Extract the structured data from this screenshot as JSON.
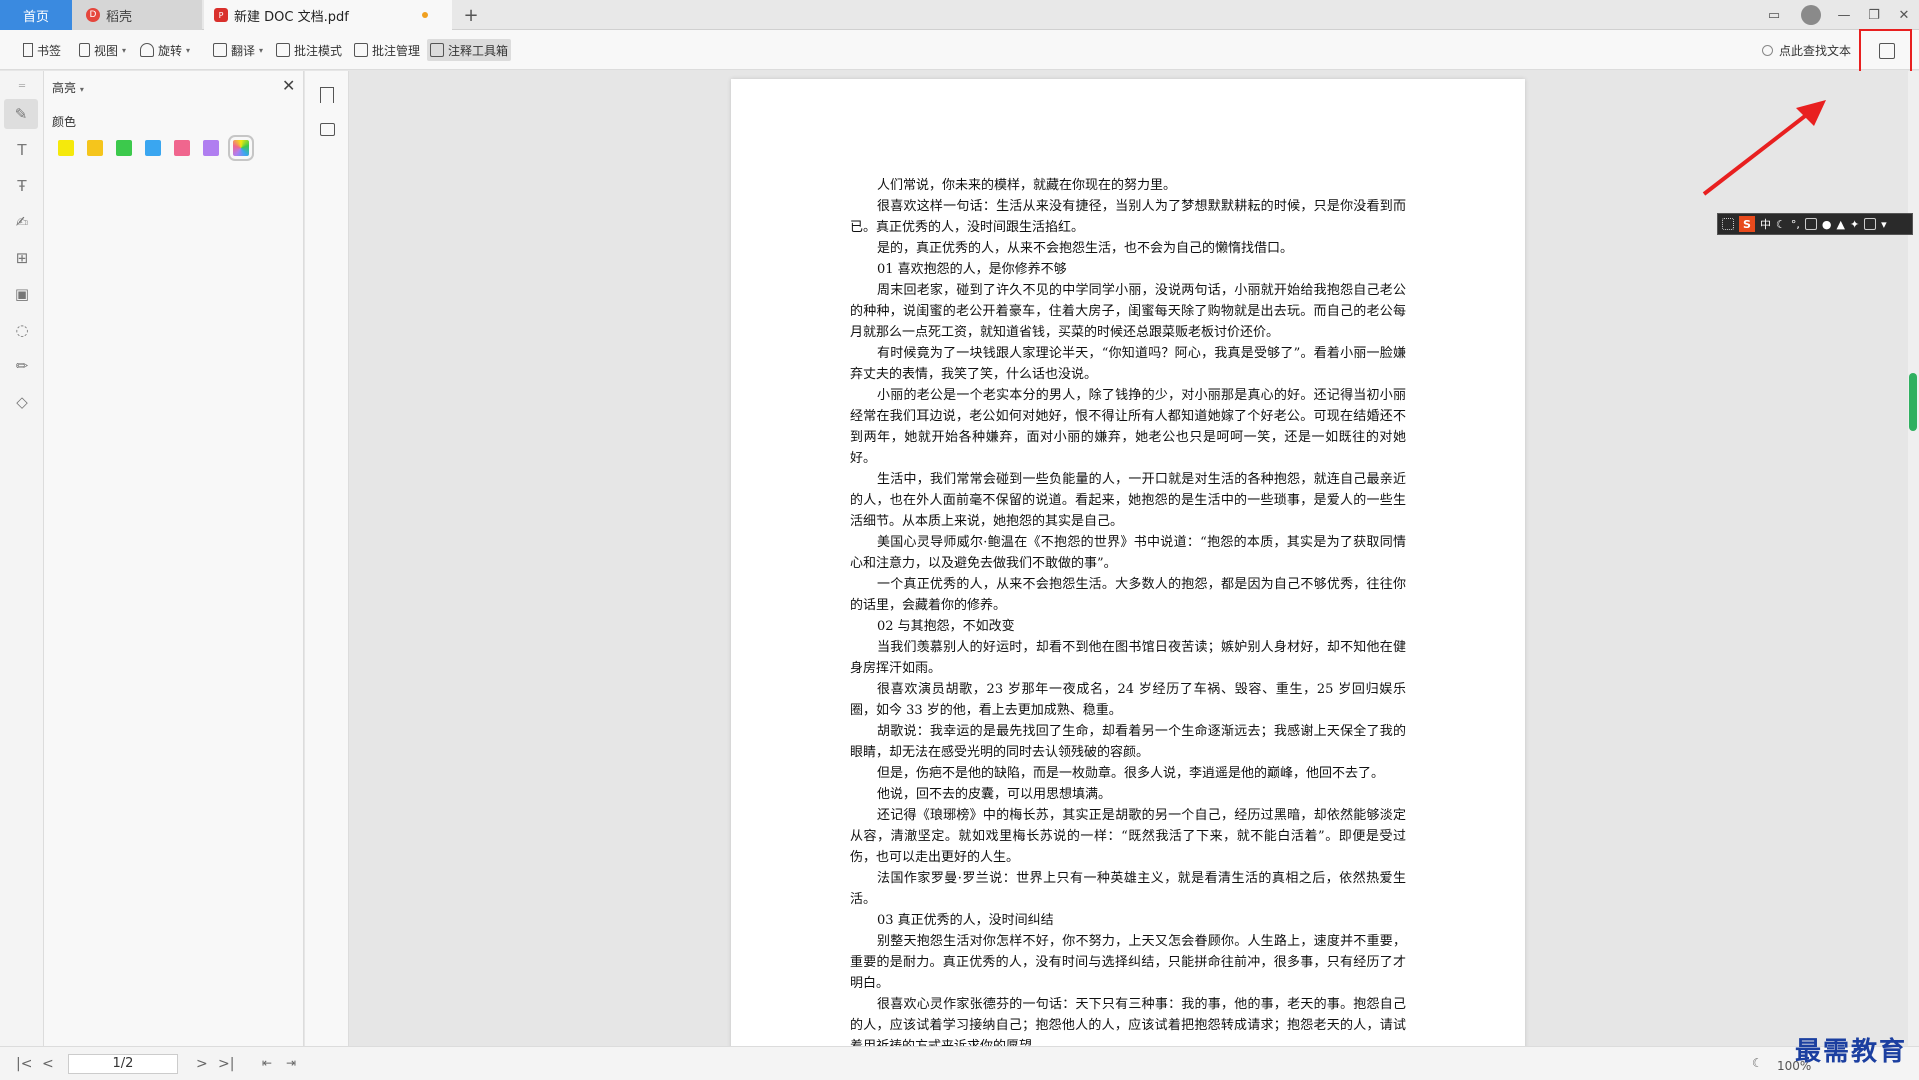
{
  "tabs": {
    "home": "首页",
    "docer": "稻壳",
    "pdf": "新建 DOC 文档.pdf",
    "add": "+"
  },
  "toolbar": {
    "bookmark": "书签",
    "view": "视图",
    "rotate": "旋转",
    "translate": "翻译",
    "annotation_mode": "批注模式",
    "annotation_manage": "批注管理",
    "annotation_toolbox": "注释工具箱",
    "find_text": "点此查找文本"
  },
  "highlight_panel": {
    "title": "高亮",
    "color_label": "颜色",
    "colors": [
      "#f5e90c",
      "#f5c51c",
      "#3cc94c",
      "#3aa6f0",
      "#f0668e",
      "#b07ef0"
    ],
    "selected": "palette"
  },
  "document": {
    "paragraphs": [
      "人们常说，你未来的模样，就藏在你现在的努力里。",
      "很喜欢这样一句话：生活从来没有捷径，当别人为了梦想默默耕耘的时候，只是你没看到而已。真正优秀的人，没时间跟生活掐红。",
      "是的，真正优秀的人，从来不会抱怨生活，也不会为自己的懒惰找借口。",
      "01 喜欢抱怨的人，是你修养不够",
      "周末回老家，碰到了许久不见的中学同学小丽，没说两句话，小丽就开始给我抱怨自己老公的种种，说闺蜜的老公开着豪车，住着大房子，闺蜜每天除了购物就是出去玩。而自己的老公每月就那么一点死工资，就知道省钱，买菜的时候还总跟菜贩老板讨价还价。",
      "有时候竟为了一块钱跟人家理论半天，“你知道吗？阿心，我真是受够了”。看着小丽一脸嫌弃丈夫的表情，我笑了笑，什么话也没说。",
      "小丽的老公是一个老实本分的男人，除了钱挣的少，对小丽那是真心的好。还记得当初小丽经常在我们耳边说，老公如何对她好，恨不得让所有人都知道她嫁了个好老公。可现在结婚还不到两年，她就开始各种嫌弃，面对小丽的嫌弃，她老公也只是呵呵一笑，还是一如既往的对她好。",
      "生活中，我们常常会碰到一些负能量的人，一开口就是对生活的各种抱怨，就连自己最亲近的人，也在外人面前毫不保留的说道。看起来，她抱怨的是生活中的一些琐事，是爱人的一些生活细节。从本质上来说，她抱怨的其实是自己。",
      "美国心灵导师威尔·鲍温在《不抱怨的世界》书中说道：“抱怨的本质，其实是为了获取同情心和注意力，以及避免去做我们不敢做的事”。",
      "一个真正优秀的人，从来不会抱怨生活。大多数人的抱怨，都是因为自己不够优秀，往往你的话里，会藏着你的修养。",
      "02 与其抱怨，不如改变",
      "当我们羡慕别人的好运时，却看不到他在图书馆日夜苦读；嫉妒别人身材好，却不知他在健身房挥汗如雨。",
      "很喜欢演员胡歌，23 岁那年一夜成名，24 岁经历了车祸、毁容、重生，25 岁回归娱乐圈，如今 33 岁的他，看上去更加成熟、稳重。",
      "胡歌说：我幸运的是最先找回了生命，却看着另一个生命逐渐远去；我感谢上天保全了我的眼睛，却无法在感受光明的同时去认领残破的容颜。",
      "但是，伤疤不是他的缺陷，而是一枚勋章。很多人说，李逍遥是他的巅峰，他回不去了。",
      "他说，回不去的皮囊，可以用思想填满。",
      "还记得《琅琊榜》中的梅长苏，其实正是胡歌的另一个自己，经历过黑暗，却依然能够淡定从容，清澈坚定。就如戏里梅长苏说的一样：“既然我活了下来，就不能白活着”。即便是受过伤，也可以走出更好的人生。",
      "法国作家罗曼·罗兰说：世界上只有一种英雄主义，就是看清生活的真相之后，依然热爱生活。",
      "03 真正优秀的人，没时间纠结",
      "别整天抱怨生活对你怎样不好，你不努力，上天又怎会眷顾你。人生路上，速度并不重要，重要的是耐力。真正优秀的人，没有时间与选择纠结，只能拼命往前冲，很多事，只有经历了才明白。",
      "很喜欢心灵作家张德芬的一句话：天下只有三种事：我的事，他的事，老天的事。抱怨自己的人，应该试着学习接纳自己；抱怨他人的人，应该试着把抱怨转成请求；抱怨老天的人，请试着用祈祷的方式来诉求你的愿望。"
    ]
  },
  "ime": {
    "logo": "S",
    "lang": "中"
  },
  "statusbar": {
    "page": "1/2",
    "zoom": "100%"
  },
  "watermark": "最需教育",
  "icons": [
    "bookmark-icon",
    "view-icon",
    "rotate-icon",
    "translate-icon",
    "annotation-mode-icon",
    "comment-icon",
    "toolbox-icon",
    "search-icon",
    "exit-annotation-icon"
  ]
}
